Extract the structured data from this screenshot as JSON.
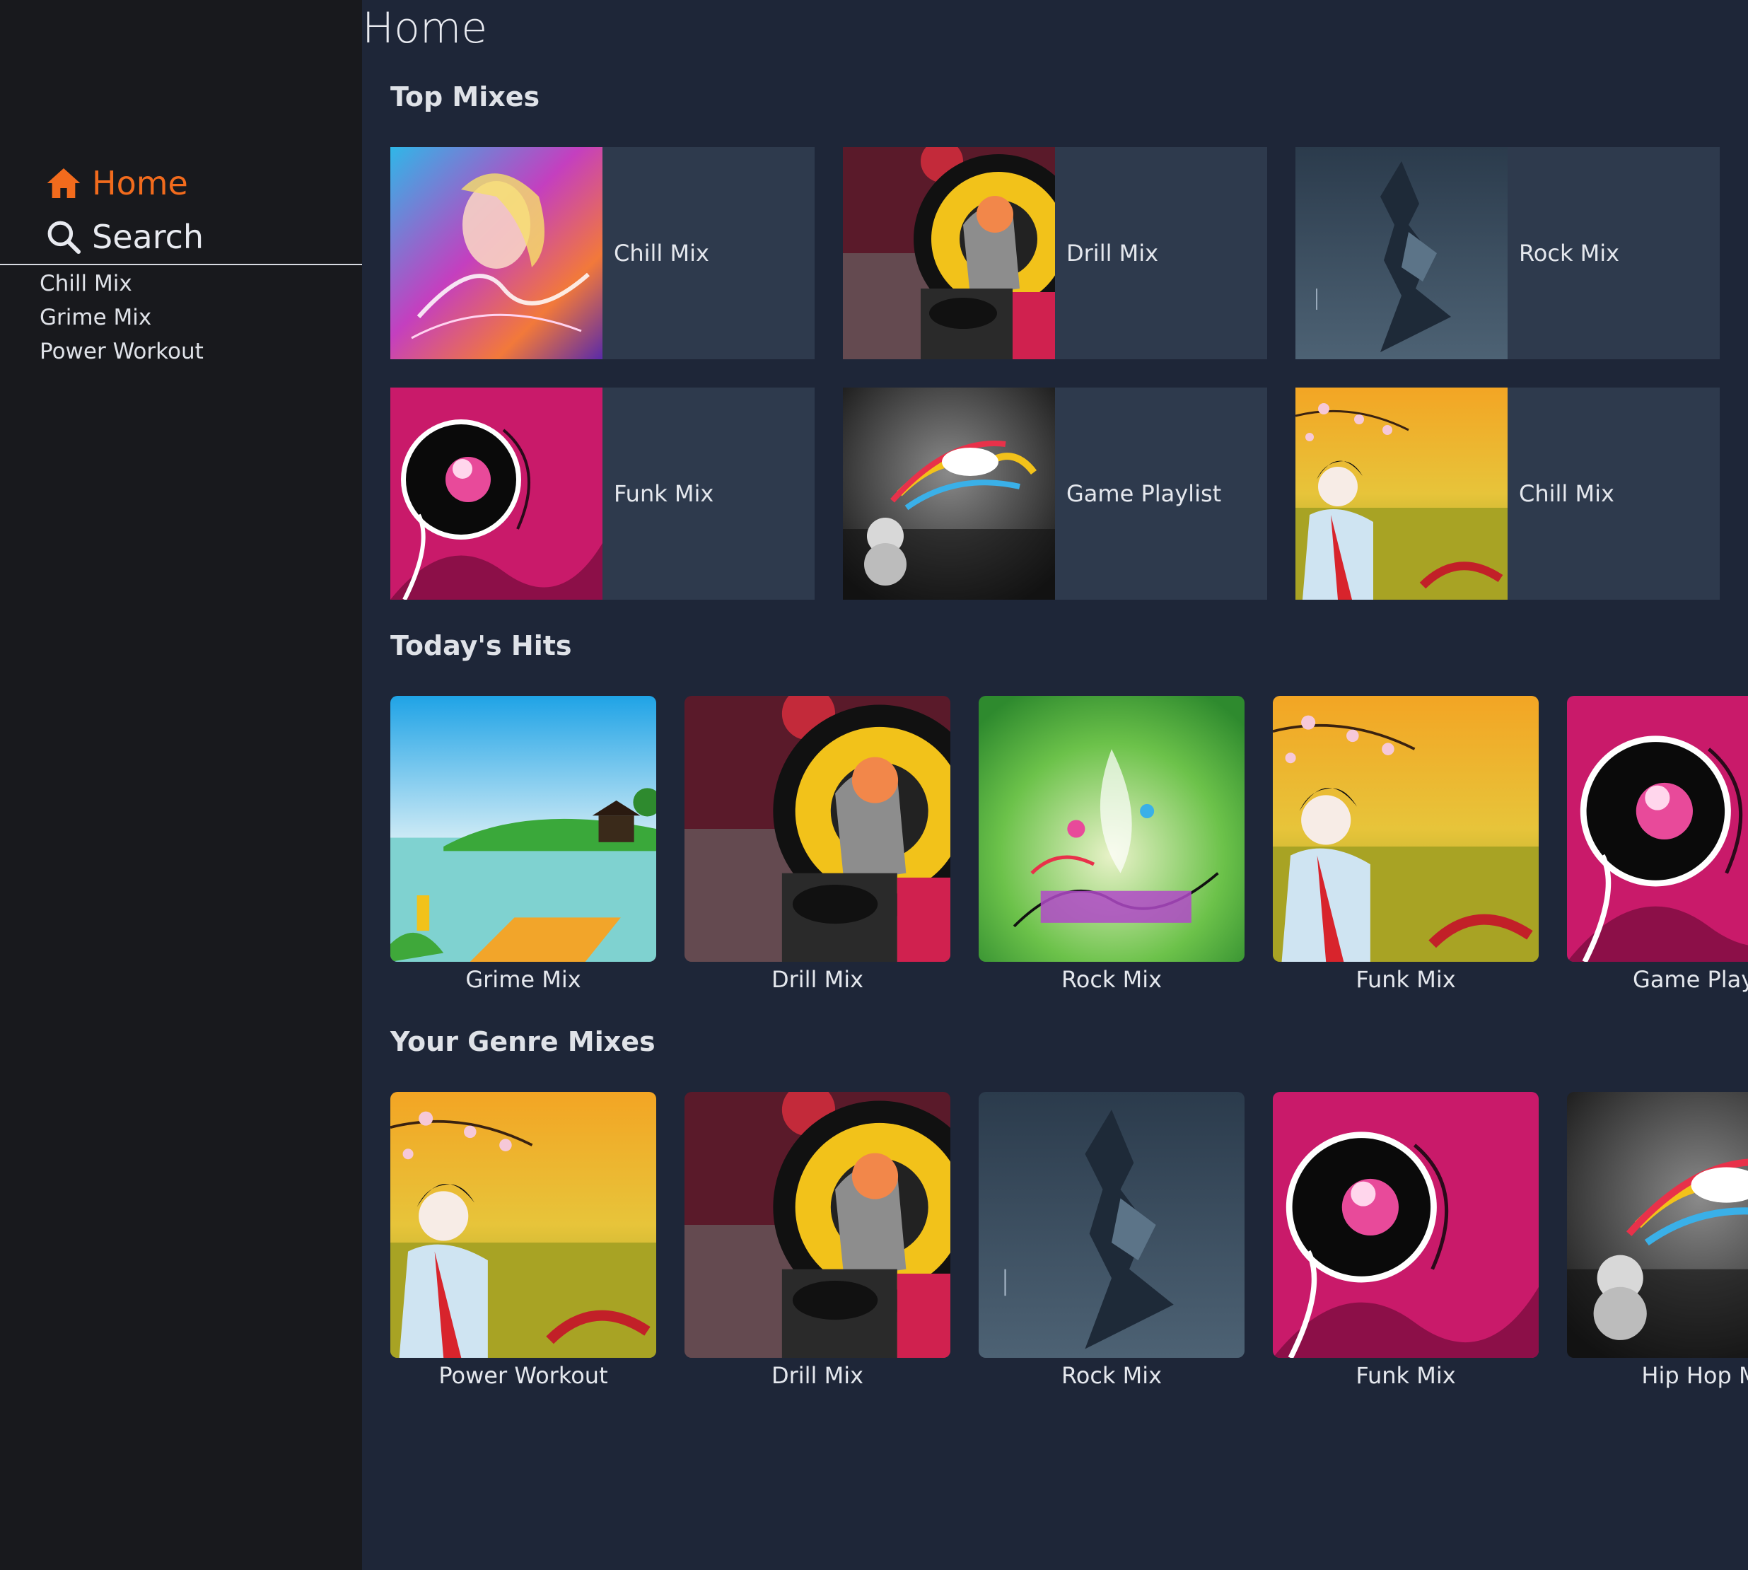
{
  "sidebar": {
    "nav": [
      {
        "label": "Home",
        "icon": "home-icon",
        "active": true,
        "color": "#f26b1d"
      },
      {
        "label": "Search",
        "icon": "search-icon",
        "active": false
      }
    ],
    "playlists": [
      "Chill Mix",
      "Grime Mix",
      "Power Workout"
    ]
  },
  "page": {
    "title": "Home"
  },
  "sections": {
    "top_mixes": {
      "title": "Top Mixes",
      "items": [
        "Chill Mix",
        "Drill Mix",
        "Rock Mix",
        "Funk Mix",
        "Game Playlist",
        "Chill Mix"
      ]
    },
    "todays_hits": {
      "title": "Today's Hits",
      "items": [
        "Grime Mix",
        "Drill Mix",
        "Rock Mix",
        "Funk Mix",
        "Game Playli"
      ]
    },
    "genre_mixes": {
      "title": "Your Genre Mixes",
      "items": [
        "Power Workout",
        "Drill Mix",
        "Rock Mix",
        "Funk Mix",
        "Hip Hop M"
      ]
    }
  },
  "colors": {
    "background": "#1e2638",
    "sidebar": "#18191d",
    "card": "#2e3a4d",
    "accent": "#f26b1d"
  }
}
